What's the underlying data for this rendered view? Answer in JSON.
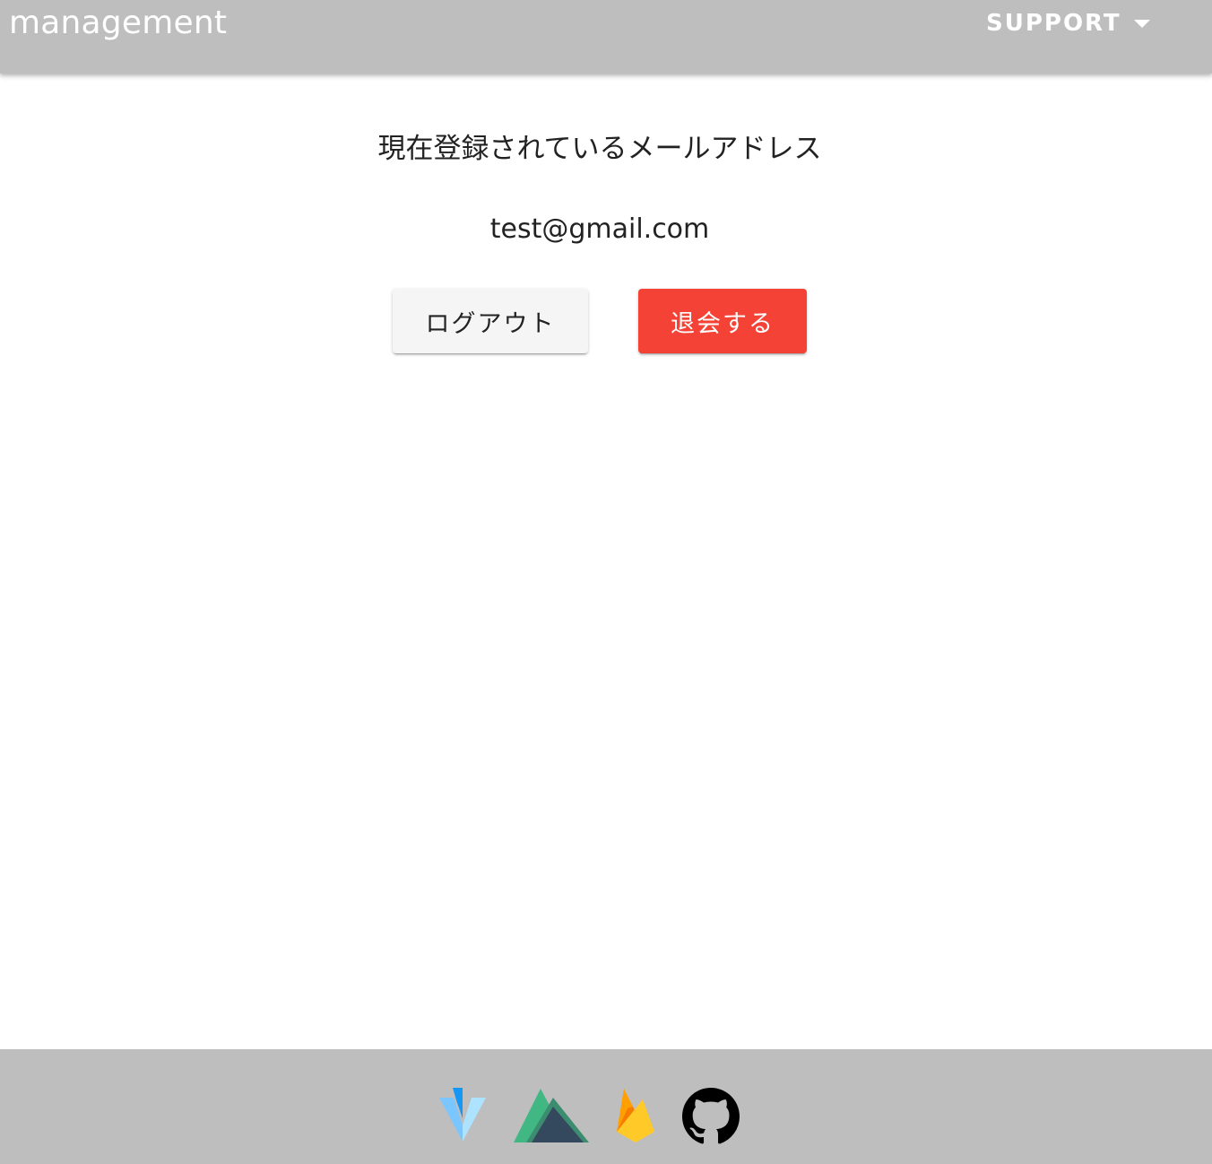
{
  "app_bar": {
    "title": "management",
    "support_menu": {
      "label": "SUPPORT",
      "icon": "caret-down-icon"
    }
  },
  "account": {
    "heading": "現在登録されているメールアドレス",
    "email": "test@gmail.com",
    "logout_label": "ログアウト",
    "withdraw_label": "退会する"
  },
  "footer": {
    "icons": [
      "vuetify-icon",
      "nuxt-icon",
      "firebase-icon",
      "github-icon"
    ]
  },
  "colors": {
    "app_bar_bg": "#bebebe",
    "footer_bg": "#bebebe",
    "withdraw_button": "#f44336",
    "logout_button": "#f5f5f5",
    "text": "#222222"
  }
}
